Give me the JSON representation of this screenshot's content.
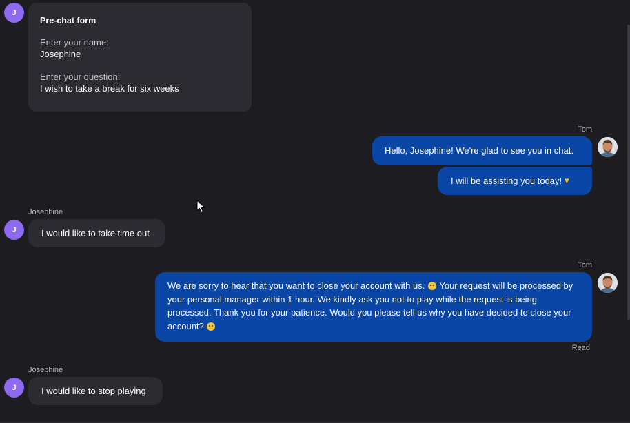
{
  "prechat": {
    "title": "Pre-chat form",
    "name_label": "Enter your name:",
    "name_value": "Josephine",
    "question_label": "Enter your question:",
    "question_value": "I wish to take a break for six weeks"
  },
  "user": {
    "initial": "J",
    "name": "Josephine"
  },
  "agent": {
    "name": "Tom"
  },
  "messages": {
    "m1": "Hello, Josephine! We're glad to see you in chat.",
    "m2": "I will be assisting you today!",
    "m3": "I would like to take time out",
    "m4_part1": "We are sorry to hear that you want to close your account with us.",
    "m4_part2": "Your request will be processed by your personal manager within 1 hour. We kindly ask you not to play while the request is being processed. Thank you for your patience. Would you please tell us why you have decided to close your account?",
    "m5": "I would like to stop playing"
  },
  "status": {
    "read": "Read"
  },
  "colors": {
    "accent": "#0a46a6",
    "avatar": "#8e6af0",
    "background": "#1d1c21",
    "incoming": "#2c2b31"
  }
}
